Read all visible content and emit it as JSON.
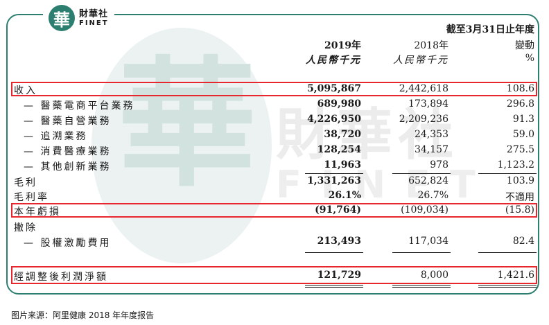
{
  "brand": {
    "mark": "華",
    "name_cn": "財華社",
    "name_en": "FINET"
  },
  "watermark": {
    "char": "華",
    "text_cn": "財華社",
    "text_en": "FINET"
  },
  "header": {
    "period": "截至3月31日止年度",
    "col1_year": "2019年",
    "col2_year": "2018年",
    "col3_title": "變動",
    "col1_unit": "人民幣千元",
    "col2_unit": "人民幣千元",
    "col3_unit": "%"
  },
  "rows": [
    {
      "label": "收入",
      "v2019": "5,095,867",
      "v2018": "2,442,618",
      "change": "108.6"
    },
    {
      "label": "— 醫藥電商平台業務",
      "v2019": "689,980",
      "v2018": "173,894",
      "change": "296.8"
    },
    {
      "label": "— 醫藥自營業務",
      "v2019": "4,226,950",
      "v2018": "2,209,236",
      "change": "91.3"
    },
    {
      "label": "— 追溯業務",
      "v2019": "38,720",
      "v2018": "24,353",
      "change": "59.0"
    },
    {
      "label": "— 消費醫療業務",
      "v2019": "128,254",
      "v2018": "34,157",
      "change": "275.5"
    },
    {
      "label": "— 其他創新業務",
      "v2019": "11,963",
      "v2018": "978",
      "change": "1,123.2"
    },
    {
      "label": "毛利",
      "v2019": "1,331,263",
      "v2018": "652,824",
      "change": "103.9"
    },
    {
      "label": "毛利率",
      "v2019": "26.1%",
      "v2018": "26.7%",
      "change": "不適用"
    },
    {
      "label": "本年虧損",
      "v2019": "(91,764)",
      "v2018": "(109,034)",
      "change": "(15.8)"
    },
    {
      "label": "撇除",
      "v2019": "",
      "v2018": "",
      "change": ""
    },
    {
      "label": "— 股權激勵費用",
      "v2019": "213,493",
      "v2018": "117,034",
      "change": "82.4"
    },
    {
      "label": "經調整後利潤淨額",
      "v2019": "121,729",
      "v2018": "8,000",
      "change": "1,421.6"
    }
  ],
  "highlight_color": "#e8262d",
  "accent_color": "#2c7f70",
  "source": "图片来源：阿里健康 2018 年年度报告"
}
